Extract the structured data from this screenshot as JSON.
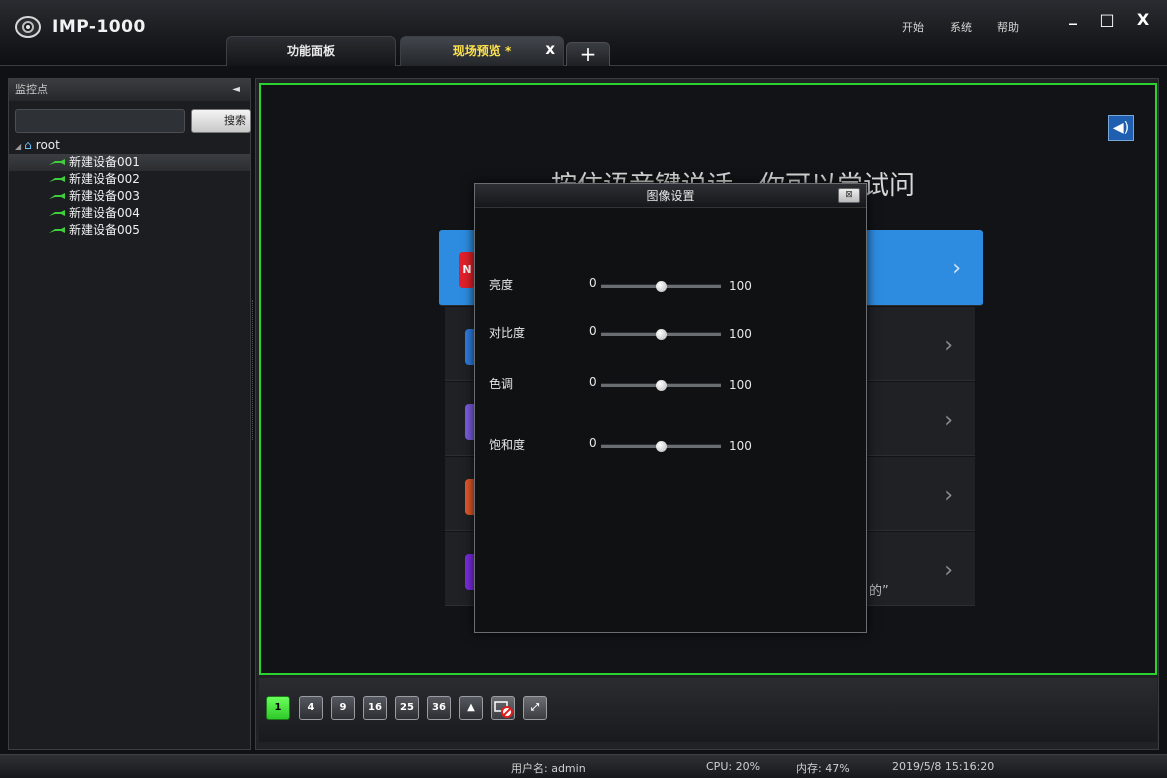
{
  "app": {
    "title": "IMP-1000"
  },
  "tabs": [
    {
      "label": "功能面板"
    },
    {
      "label": "现场预览 *"
    }
  ],
  "tab_close": "x",
  "tab_add": "+",
  "menu": {
    "start": "开始",
    "system": "系统",
    "help": "帮助"
  },
  "window": {
    "minimize": "_",
    "maximize": "□",
    "close": "X"
  },
  "sidebar": {
    "header": "监控点",
    "collapse": "◄",
    "search": {
      "value": "",
      "button": "搜索"
    },
    "tree": {
      "root": "root",
      "devices": [
        "新建设备001",
        "新建设备002",
        "新建设备003",
        "新建设备004",
        "新建设备005"
      ],
      "selected_index": 0
    }
  },
  "background_overlay": {
    "text": "按住语音键说话，你可以尝试问",
    "quote_fragment": "的”",
    "card_letter": "N",
    "icon_colors": [
      "#e0202a",
      "#2d7be0",
      "#7a5ce0",
      "#e0582a",
      "#7a2ce0"
    ]
  },
  "dialog": {
    "title": "图像设置",
    "close": "⊠",
    "sliders": [
      {
        "label": "亮度",
        "min": "0",
        "max": "100",
        "value": 50
      },
      {
        "label": "对比度",
        "min": "0",
        "max": "100",
        "value": 50
      },
      {
        "label": "色调",
        "min": "0",
        "max": "100",
        "value": 50
      },
      {
        "label": "饱和度",
        "min": "0",
        "max": "100",
        "value": 50
      }
    ]
  },
  "toolbar": {
    "layouts": [
      "1",
      "4",
      "9",
      "16",
      "25",
      "36"
    ],
    "active_layout": "1",
    "extra_icons": [
      "eject-icon",
      "stop-all-icon",
      "fullscreen-icon"
    ]
  },
  "status": {
    "user": "用户名: admin",
    "cpu": "CPU: 20%",
    "memory": "内存: 47%",
    "datetime": "2019/5/8 15:16:20"
  },
  "colors": {
    "active_tab_text": "#ffe34d",
    "video_border": "#2ad32e",
    "active_layout": "#4fe043",
    "highlight_card": "#2d8ce0"
  }
}
